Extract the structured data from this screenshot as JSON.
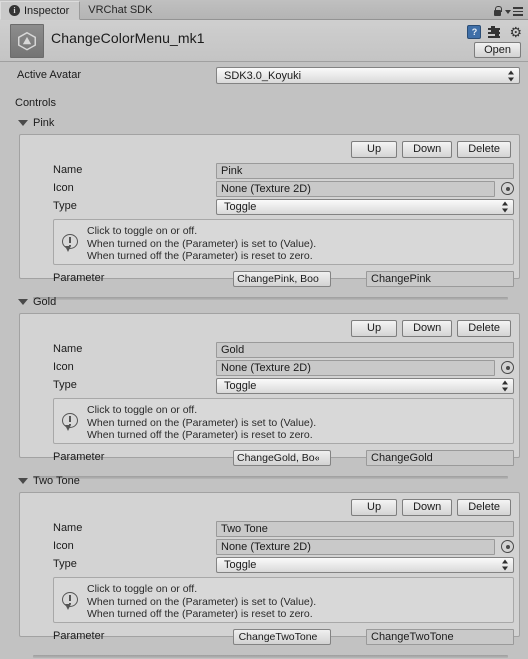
{
  "tabs": [
    {
      "label": "Inspector",
      "icon": "info-icon",
      "active": true
    },
    {
      "label": "VRChat SDK",
      "icon": null,
      "active": false
    }
  ],
  "tabbar_right": {
    "lock_icon": "lock-icon",
    "menu_icon": "hamburger-menu-icon"
  },
  "object_header": {
    "icon": "unity-script-icon",
    "title": "ChangeColorMenu_mk1",
    "help_icon": "help-icon",
    "help_label": "?",
    "preset_icon": "preset-icon",
    "gear_icon": "gear-icon",
    "gear_glyph": "⚙",
    "open_label": "Open"
  },
  "active_avatar": {
    "label": "Active Avatar",
    "value": "SDK3.0_Koyuki"
  },
  "controls_label": "Controls",
  "field_labels": {
    "name": "Name",
    "icon": "Icon",
    "type": "Type",
    "parameter": "Parameter"
  },
  "buttons": {
    "up": "Up",
    "down": "Down",
    "delete": "Delete"
  },
  "helpbox": {
    "icon": "warning-icon",
    "line1": "Click to toggle on or off.",
    "line2": "When turned on the (Parameter) is set to (Value).",
    "line3": "When turned off the (Parameter) is reset to zero."
  },
  "icon_field_value": "None (Texture 2D)",
  "type_value": "Toggle",
  "controls": [
    {
      "foldout": "Pink",
      "name": "Pink",
      "icon": "None (Texture 2D)",
      "type": "Toggle",
      "parameter_popup": "ChangePink, Boo",
      "parameter_name": "ChangePink"
    },
    {
      "foldout": "Gold",
      "name": "Gold",
      "icon": "None (Texture 2D)",
      "type": "Toggle",
      "parameter_popup": "ChangeGold, Bo«",
      "parameter_name": "ChangeGold"
    },
    {
      "foldout": "Two Tone",
      "name": "Two Tone",
      "icon": "None (Texture 2D)",
      "type": "Toggle",
      "parameter_popup": "ChangeTwoTone",
      "parameter_name": "ChangeTwoTone"
    }
  ],
  "colors": {
    "window_bg": "#c2c2c2",
    "block_bg": "#d3d3d3",
    "field_bg": "#c9c9c9",
    "border": "#a2a2a2",
    "text": "#1b1b1b",
    "help_blue": "#3f6fa8"
  }
}
